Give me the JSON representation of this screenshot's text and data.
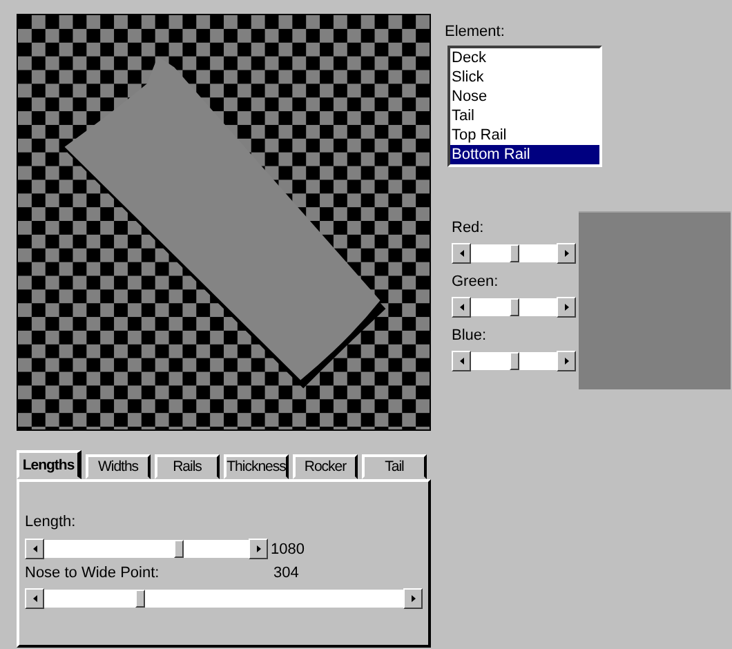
{
  "element": {
    "label": "Element:",
    "items": [
      {
        "label": "Deck",
        "selected": false
      },
      {
        "label": "Slick",
        "selected": false
      },
      {
        "label": "Nose",
        "selected": false
      },
      {
        "label": "Tail",
        "selected": false
      },
      {
        "label": "Top Rail",
        "selected": false
      },
      {
        "label": "Bottom Rail",
        "selected": true
      }
    ]
  },
  "color_sliders": [
    {
      "label": "Red:",
      "level": 0.5
    },
    {
      "label": "Green:",
      "level": 0.5
    },
    {
      "label": "Blue:",
      "level": 0.5
    }
  ],
  "tabs": [
    {
      "label": "Lengths",
      "selected": true
    },
    {
      "label": "Widths",
      "selected": false
    },
    {
      "label": "Rails",
      "selected": false
    },
    {
      "label": "Thickness",
      "selected": false
    },
    {
      "label": "Rocker",
      "selected": false
    },
    {
      "label": "Tail",
      "selected": false
    }
  ],
  "length": {
    "label": "Length:",
    "level": 0.67,
    "reading": "1080"
  },
  "nose_to_wide_point": {
    "label": "Nose to Wide Point:",
    "level": 0.26,
    "reading": "304"
  }
}
